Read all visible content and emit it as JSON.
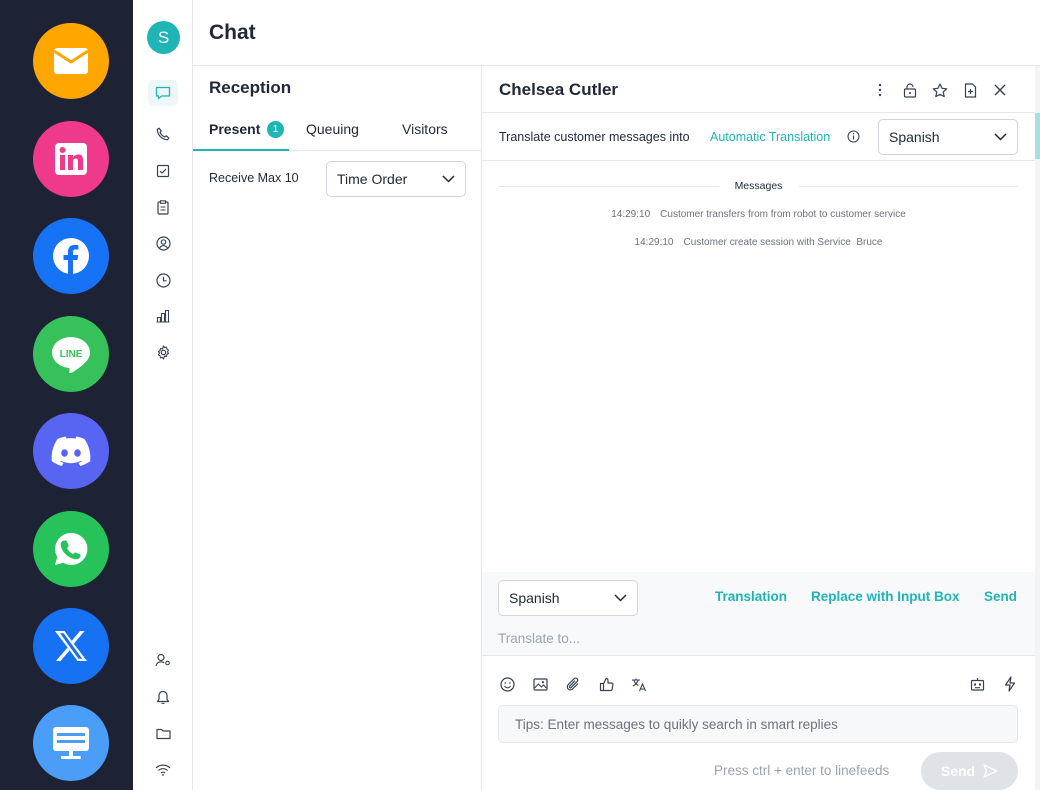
{
  "channels": [
    {
      "name": "email",
      "color": "#ffa600",
      "icon": "mail-icon"
    },
    {
      "name": "linkedin",
      "color": "#ef3a8c",
      "icon": "linkedin-icon"
    },
    {
      "name": "facebook",
      "color": "#1673f5",
      "icon": "facebook-icon"
    },
    {
      "name": "line",
      "color": "#36c15a",
      "icon": "line-icon"
    },
    {
      "name": "discord",
      "color": "#5865f2",
      "icon": "discord-icon"
    },
    {
      "name": "whatsapp",
      "color": "#27c25a",
      "icon": "whatsapp-icon"
    },
    {
      "name": "x",
      "color": "#1672f3",
      "icon": "x-icon"
    },
    {
      "name": "desktop",
      "color": "#4a9ef8",
      "icon": "monitor-icon"
    }
  ],
  "user": {
    "initial": "S"
  },
  "header": {
    "title": "Chat"
  },
  "reception": {
    "title": "Reception",
    "tabs": {
      "present": "Present",
      "present_count": "1",
      "queuing": "Queuing",
      "visitors": "Visitors"
    },
    "receive_max": "Receive Max 10",
    "order": "Time Order"
  },
  "conversation": {
    "customer_name": "Chelsea Cutler",
    "translate_label": "Translate customer messages into",
    "auto_translation": "Automatic Translation",
    "target_language": "Spanish",
    "divider_label": "Messages",
    "events": [
      {
        "time": "14:29:10",
        "text": "Customer transfers from from robot to customer service"
      },
      {
        "time": "14:29:10",
        "text": "Customer create session with Service  Bruce"
      }
    ]
  },
  "composer": {
    "language": "Spanish",
    "translation": "Translation",
    "replace": "Replace with Input Box",
    "send_link": "Send",
    "translate_placeholder": "Translate to...",
    "input_placeholder": "Tips: Enter messages to quikly search in smart replies",
    "hint": "Press ctrl + enter to linefeeds",
    "send_button": "Send"
  },
  "accent_color": "#1fb5b5"
}
